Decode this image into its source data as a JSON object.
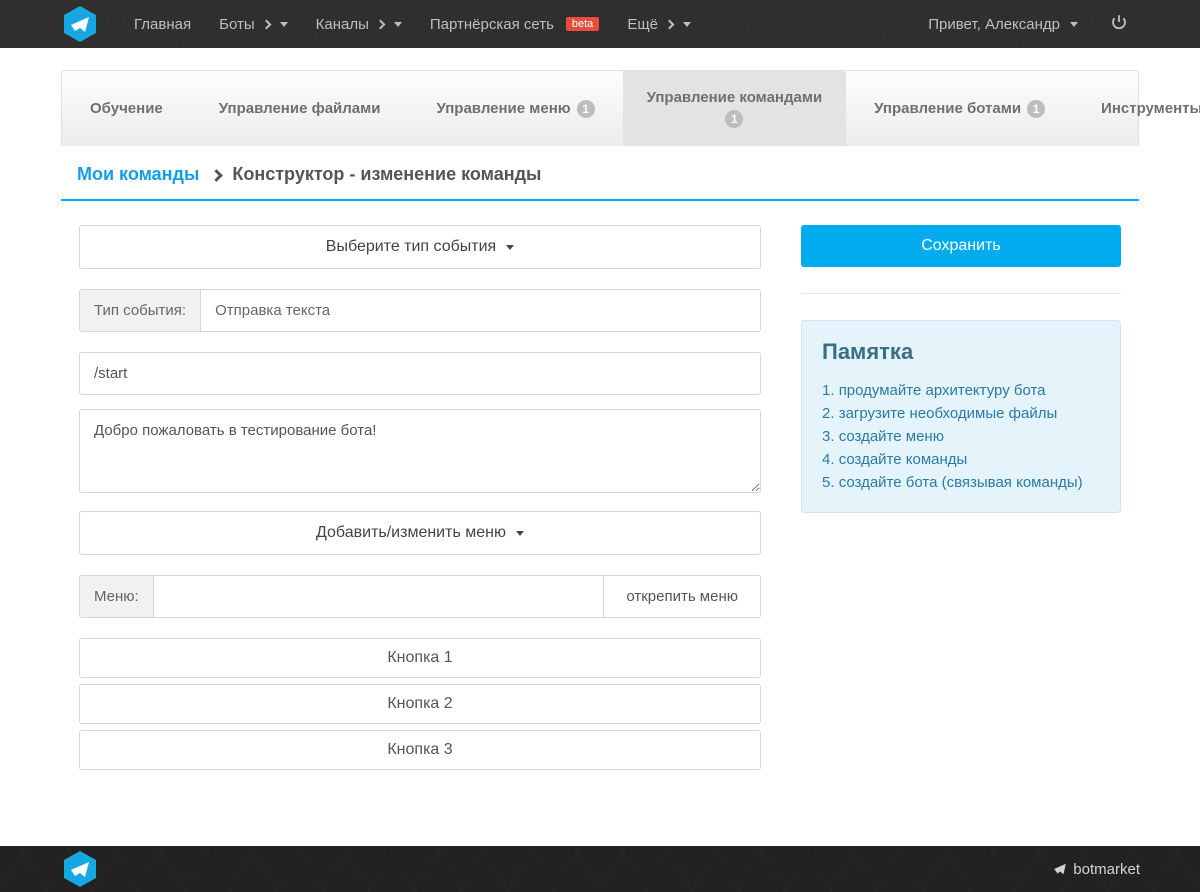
{
  "nav": {
    "items": [
      {
        "label": "Главная",
        "dropdown": false
      },
      {
        "label": "Боты",
        "dropdown": true
      },
      {
        "label": "Каналы",
        "dropdown": true
      },
      {
        "label": "Партнёрская сеть",
        "dropdown": false,
        "beta": "beta"
      },
      {
        "label": "Ещё",
        "dropdown": true
      }
    ],
    "greeting": "Привет, Александр"
  },
  "tabs": [
    {
      "label": "Обучение",
      "badge": null
    },
    {
      "label": "Управление файлами",
      "badge": null
    },
    {
      "label": "Управление меню",
      "badge": "1"
    },
    {
      "label": "Управление командами",
      "badge": "1",
      "active": true
    },
    {
      "label": "Управление ботами",
      "badge": "1"
    },
    {
      "label": "Инструменты",
      "badge": null
    }
  ],
  "breadcrumb": {
    "link": "Мои команды",
    "current": "Конструктор - изменение команды"
  },
  "form": {
    "event_type_dropdown": "Выберите тип события",
    "event_type_label": "Тип события:",
    "event_type_value": "Отправка текста",
    "command_input": "/start",
    "message_text": "Добро пожаловать в тестирование бота!",
    "menu_dropdown": "Добавить/изменить меню",
    "menu_label": "Меню:",
    "menu_value": "",
    "detach_menu": "открепить меню",
    "buttons": [
      "Кнопка 1",
      "Кнопка 2",
      "Кнопка 3"
    ]
  },
  "sidebar": {
    "save": "Сохранить",
    "hint_title": "Памятка",
    "hints": [
      "продумайте архитектуру бота",
      "загрузите необходимые файлы",
      "создайте меню",
      "создайте команды",
      "создайте бота (связывая команды)"
    ]
  },
  "footer": {
    "brand": "botmarket"
  }
}
